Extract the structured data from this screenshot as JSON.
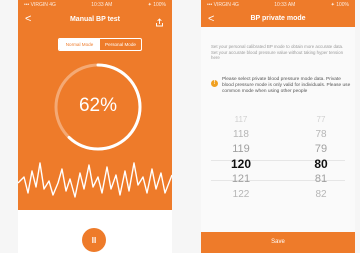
{
  "left_screen": {
    "status_left": "••• VIRGIN 4G",
    "status_time": "10:33 AM",
    "status_right": "✦ 100%",
    "back_glyph": "<",
    "title": "Manual BP test",
    "share_icon": "share-icon",
    "modes": [
      {
        "label": "Normal Mode",
        "active": true
      },
      {
        "label": "Personal Mode",
        "active": false
      }
    ],
    "progress_label": "62%",
    "progress_value": 0.62,
    "pause_label": "II",
    "accent_color": "#ee7b2a"
  },
  "right_screen": {
    "status_left": "••• VIRGIN 4G",
    "status_time": "10:33 AM",
    "status_right": "✦ 100%",
    "back_glyph": "<",
    "title": "BP private mode",
    "description": "Set your personal calibrated BP mode to obtain more accurate data. Set your accurate blood pressure value without taking hyper tension here",
    "warning_icon": "warning-icon",
    "warning_text": "Please select private blood pressure mode data. Private blood pressure mode is only valid for individuals. Please use common mode when using other people",
    "systolic_values": [
      "117",
      "118",
      "119",
      "120",
      "121",
      "122"
    ],
    "diastolic_values": [
      "77",
      "78",
      "79",
      "80",
      "81",
      "82"
    ],
    "selected_index": 3,
    "save_label": "Save"
  }
}
